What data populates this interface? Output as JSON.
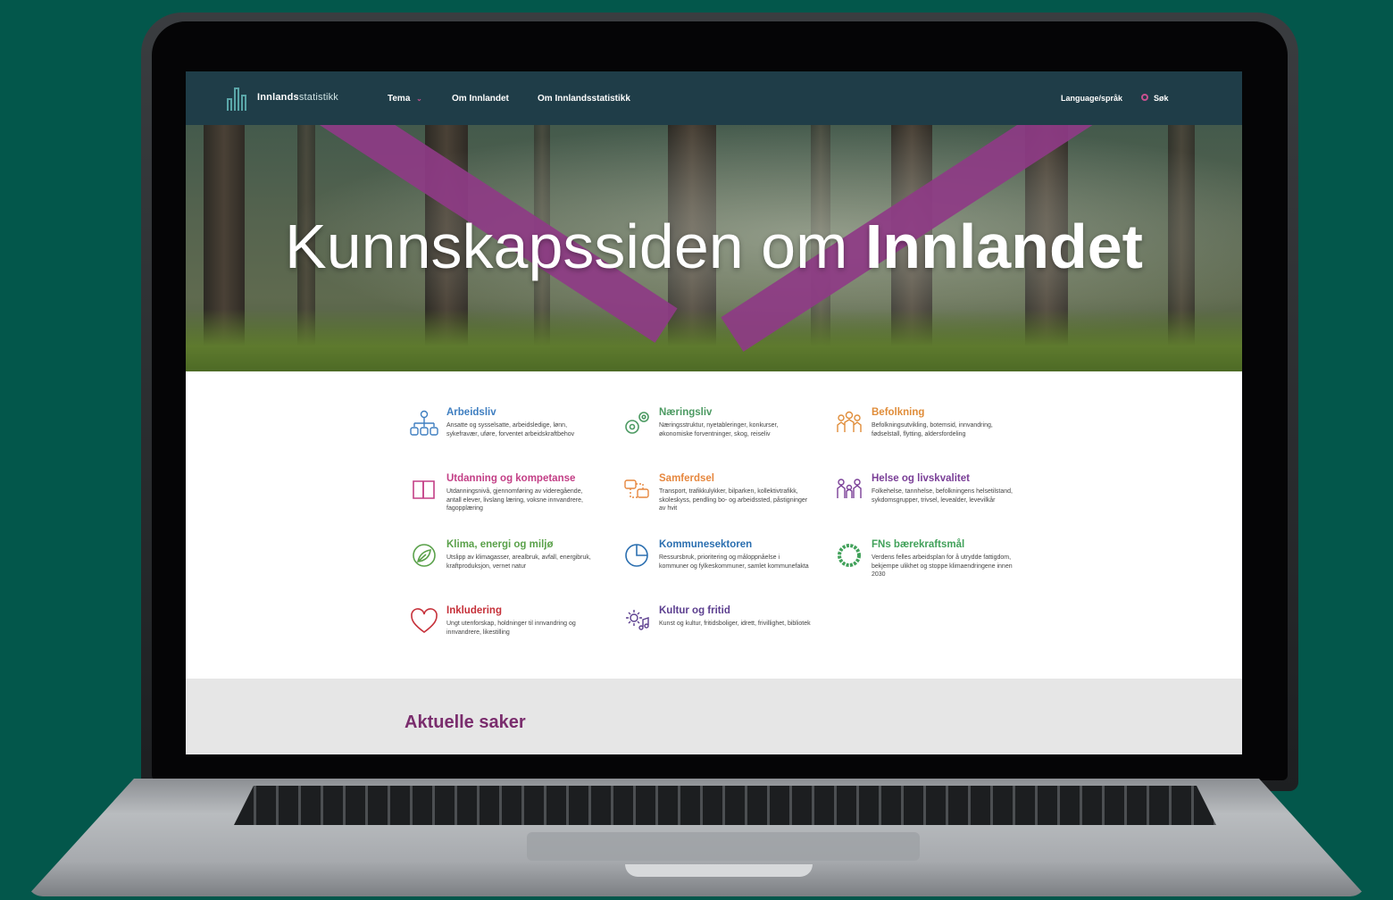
{
  "header": {
    "logo_bold": "Innlands",
    "logo_light": "statistikk",
    "nav": [
      "Tema",
      "Om Innlandet",
      "Om Innlandsstatistikk"
    ],
    "language": "Language/språk",
    "search": "Søk"
  },
  "hero": {
    "title_regular": "Kunnskapssiden om ",
    "title_bold": "Innlandet"
  },
  "topics": [
    {
      "title": "Arbeidsliv",
      "color": "#3e7ec0",
      "icon": "org-chart-icon",
      "desc": "Ansatte og sysselsatte, arbeidsledige, lønn, sykefravær, uføre, forventet arbeidskraftbehov"
    },
    {
      "title": "Næringsliv",
      "color": "#4c9a62",
      "icon": "gears-icon",
      "desc": "Næringsstruktur, nyetableringer, konkurser, økonomiske forventninger, skog, reiseliv"
    },
    {
      "title": "Befolkning",
      "color": "#e08d3a",
      "icon": "people-icon",
      "desc": "Befolkningsutvikling, botemsid, innvandring, fødselstall, flytting, aldersfordeling"
    },
    {
      "title": "Utdanning og kompetanse",
      "color": "#c33f86",
      "icon": "book-icon",
      "desc": "Utdanningsnivå, gjennomføring av videregående, antall elever, livslang læring, voksne innvandrere, fagopplæring"
    },
    {
      "title": "Samferdsel",
      "color": "#e6873e",
      "icon": "transport-icon",
      "desc": "Transport, trafikkulykker, bilparken, kollektivtrafikk, skoleskyss, pendling bo- og arbeidssted, påstigninger av hvit"
    },
    {
      "title": "Helse og livskvalitet",
      "color": "#7a3f97",
      "icon": "family-icon",
      "desc": "Folkehelse, tannhelse, befolkningens helsetilstand, sykdomsgrupper, trivsel, levealder, levevilkår"
    },
    {
      "title": "Klima, energi og miljø",
      "color": "#5aa14a",
      "icon": "leaf-icon",
      "desc": "Utslipp av klimagasser, arealbruk, avfall, energibruk, kraftproduksjon, vernet natur"
    },
    {
      "title": "Kommunesektoren",
      "color": "#2b6fb0",
      "icon": "pie-chart-icon",
      "desc": "Ressursbruk, prioritering og måloppnåelse i kommuner og fylkeskommuner, samlet kommunefakta"
    },
    {
      "title": "FNs bærekraftsmål",
      "color": "#41a15a",
      "icon": "sdg-wheel-icon",
      "desc": "Verdens felles arbeidsplan for å utrydde fattigdom, bekjempe ulikhet og stoppe klimaendringene innen 2030"
    },
    {
      "title": "Inkludering",
      "color": "#c6313a",
      "icon": "heart-icon",
      "desc": "Ungt utenforskap, holdninger til innvandring og innvandrere, likestilling"
    },
    {
      "title": "Kultur og fritid",
      "color": "#5c3f8f",
      "icon": "culture-icon",
      "desc": "Kunst og kultur, fritidsboliger, idrett, frivillighet, bibliotek"
    }
  ],
  "current": {
    "title": "Aktuelle saker"
  }
}
